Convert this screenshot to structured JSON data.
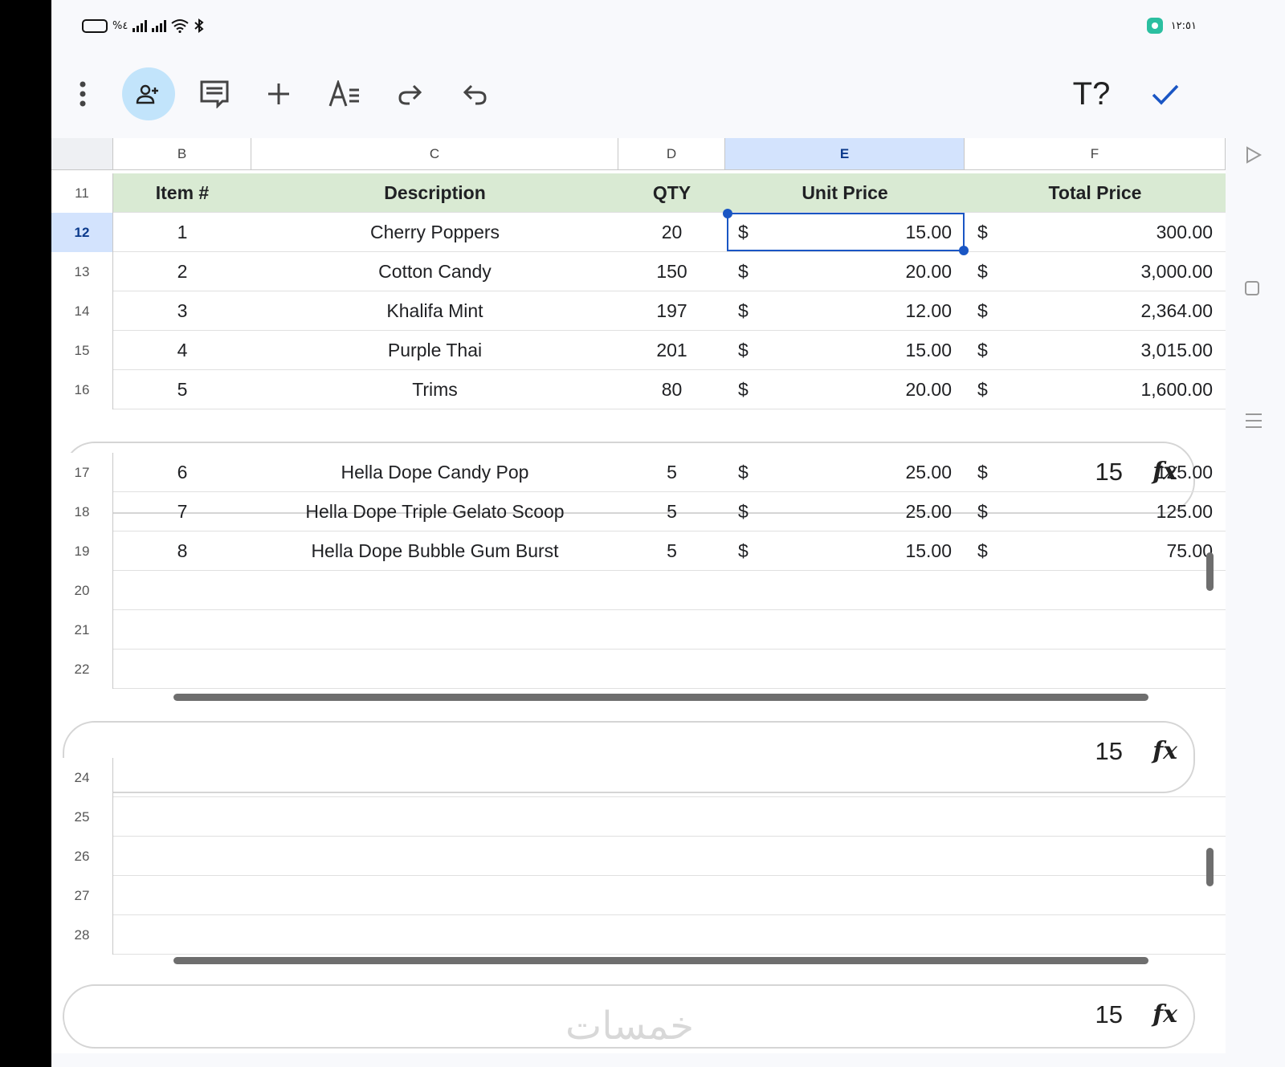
{
  "status_bar": {
    "battery_text": "%٤",
    "time": "١٢:٥١"
  },
  "toolbar": {
    "text_style_label": "T?"
  },
  "columns": [
    "B",
    "C",
    "D",
    "E",
    "F"
  ],
  "selected_column": "E",
  "rows_top": [
    {
      "num": "11",
      "header": true,
      "item": "Item #",
      "desc": "Description",
      "qty": "QTY",
      "unit": "Unit Price",
      "total": "Total Price"
    },
    {
      "num": "12",
      "selected": true,
      "item": "1",
      "desc": "Cherry Poppers",
      "qty": "20",
      "cur1": "$",
      "unit": "15.00",
      "cur2": "$",
      "total": "300.00"
    },
    {
      "num": "13",
      "item": "2",
      "desc": "Cotton Candy",
      "qty": "150",
      "cur1": "$",
      "unit": "20.00",
      "cur2": "$",
      "total": "3,000.00"
    },
    {
      "num": "14",
      "item": "3",
      "desc": "Khalifa Mint",
      "qty": "197",
      "cur1": "$",
      "unit": "12.00",
      "cur2": "$",
      "total": "2,364.00"
    },
    {
      "num": "15",
      "item": "4",
      "desc": "Purple Thai",
      "qty": "201",
      "cur1": "$",
      "unit": "15.00",
      "cur2": "$",
      "total": "3,015.00"
    },
    {
      "num": "16",
      "item": "5",
      "desc": "Trims",
      "qty": "80",
      "cur1": "$",
      "unit": "20.00",
      "cur2": "$",
      "total": "1,600.00"
    }
  ],
  "rows_mid": [
    {
      "num": "17",
      "item": "6",
      "desc": "Hella Dope Candy Pop",
      "qty": "5",
      "cur1": "$",
      "unit": "25.00",
      "cur2": "$",
      "total": "125.00"
    },
    {
      "num": "18",
      "item": "7",
      "desc": "Hella Dope Triple Gelato Scoop",
      "qty": "5",
      "cur1": "$",
      "unit": "25.00",
      "cur2": "$",
      "total": "125.00"
    },
    {
      "num": "19",
      "item": "8",
      "desc": "Hella Dope Bubble Gum Burst",
      "qty": "5",
      "cur1": "$",
      "unit": "15.00",
      "cur2": "$",
      "total": "75.00"
    },
    {
      "num": "20"
    },
    {
      "num": "21"
    },
    {
      "num": "22"
    }
  ],
  "rows_bottom": [
    {
      "num": "24"
    },
    {
      "num": "25"
    },
    {
      "num": "26"
    },
    {
      "num": "27"
    },
    {
      "num": "28"
    }
  ],
  "formula_bar": {
    "value": "15",
    "fx": "fx"
  },
  "watermark": "خمسات",
  "colors": {
    "accent": "#1a56c4",
    "header_fill": "#d9ead3",
    "selected_header": "#d3e3fd",
    "share_button": "#c2e4fb"
  }
}
